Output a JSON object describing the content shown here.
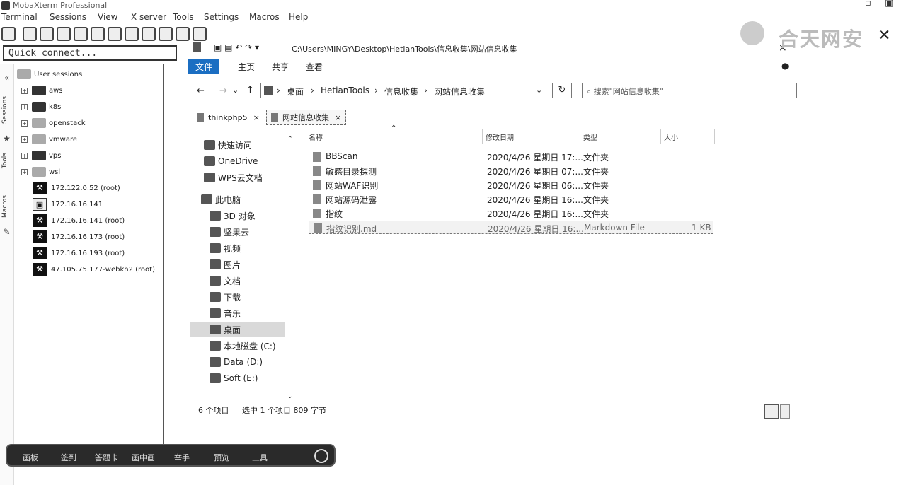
{
  "window": {
    "title": "MobaXterm Professional"
  },
  "menubar": [
    "Terminal",
    "Sessions",
    "View",
    "X server",
    "Tools",
    "Settings",
    "Macros",
    "Help"
  ],
  "quick_connect": {
    "placeholder": "Quick connect..."
  },
  "vertical_tabs": [
    "Sessions",
    "Tools",
    "Macros"
  ],
  "sessions": {
    "root": "User sessions",
    "items": [
      {
        "label": "aws",
        "kind": "folder"
      },
      {
        "label": "k8s",
        "kind": "folder"
      },
      {
        "label": "openstack",
        "kind": "folder"
      },
      {
        "label": "vmware",
        "kind": "folder"
      },
      {
        "label": "vps",
        "kind": "folder"
      },
      {
        "label": "wsl",
        "kind": "folder"
      },
      {
        "label": "172.122.0.52 (root)",
        "kind": "ssh"
      },
      {
        "label": "172.16.16.141",
        "kind": "vnc"
      },
      {
        "label": "172.16.16.141 (root)",
        "kind": "ssh"
      },
      {
        "label": "172.16.16.173 (root)",
        "kind": "ssh"
      },
      {
        "label": "172.16.16.193 (root)",
        "kind": "ssh"
      },
      {
        "label": "47.105.75.177-webkh2 (root)",
        "kind": "ssh"
      }
    ]
  },
  "explorer": {
    "path": "C:\\Users\\MINGY\\Desktop\\HetianTools\\信息收集\\网站信息收集",
    "ribbon_tabs": [
      "文件",
      "主页",
      "共享",
      "查看"
    ],
    "breadcrumb": [
      "桌面",
      "HetianTools",
      "信息收集",
      "网站信息收集"
    ],
    "search_placeholder": "搜索\"网站信息收集\"",
    "tabs": [
      "thinkphp5",
      "网站信息收集"
    ],
    "nav": [
      "快速访问",
      "OneDrive",
      "WPS云文档",
      "此电脑",
      "3D 对象",
      "坚果云",
      "视频",
      "图片",
      "文档",
      "下载",
      "音乐",
      "桌面",
      "本地磁盘 (C:)",
      "Data (D:)",
      "Soft (E:)"
    ],
    "columns": [
      "名称",
      "修改日期",
      "类型",
      "大小"
    ],
    "files": [
      {
        "name": "BBScan",
        "date": "2020/4/26 星期日 17:...",
        "type": "文件夹",
        "size": ""
      },
      {
        "name": "敏感目录探测",
        "date": "2020/4/26 星期日 07:...",
        "type": "文件夹",
        "size": ""
      },
      {
        "name": "网站WAF识别",
        "date": "2020/4/26 星期日 06:...",
        "type": "文件夹",
        "size": ""
      },
      {
        "name": "网站源码泄露",
        "date": "2020/4/26 星期日 16:...",
        "type": "文件夹",
        "size": ""
      },
      {
        "name": "指纹",
        "date": "2020/4/26 星期日 16:...",
        "type": "文件夹",
        "size": ""
      },
      {
        "name": "指纹识别.md",
        "date": "2020/4/26 星期日 16:...",
        "type": "Markdown File",
        "size": "1 KB"
      }
    ],
    "status": {
      "count": "6 个项目",
      "selected": "选中 1 个项目  809 字节"
    }
  },
  "dock": [
    "画板",
    "签到",
    "答题卡",
    "画中画",
    "举手",
    "预览",
    "工具"
  ],
  "logo_text": "合天网安"
}
